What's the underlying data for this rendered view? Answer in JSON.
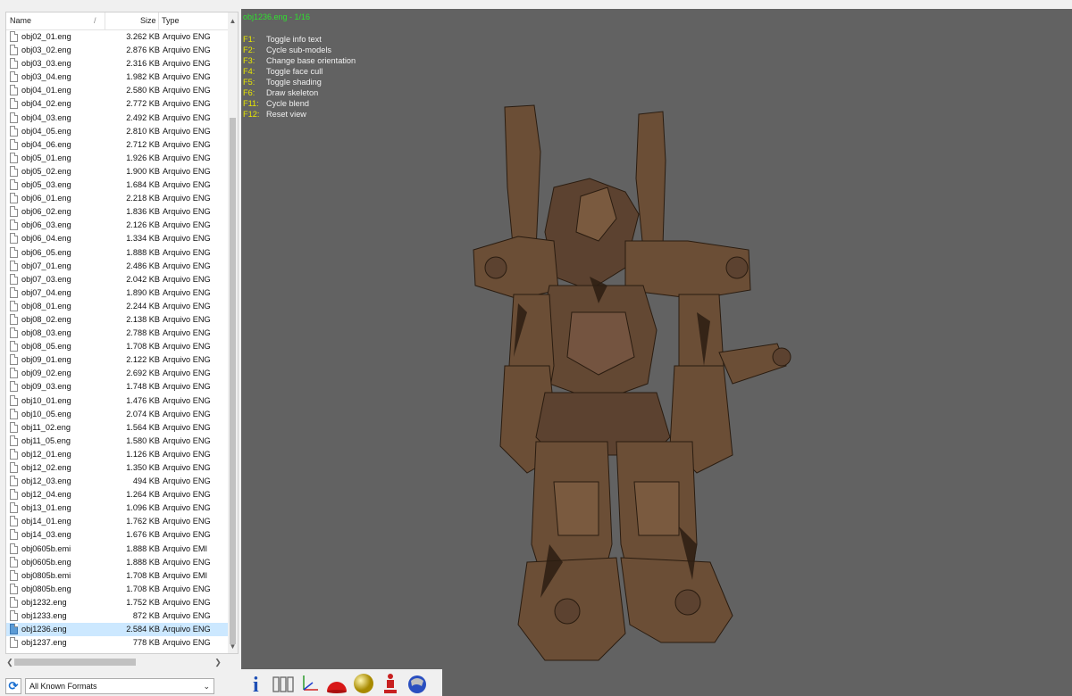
{
  "file_list": {
    "columns": {
      "name": "Name",
      "size": "Size",
      "type": "Type"
    },
    "files": [
      {
        "name": "obj02_01.eng",
        "size": "3.262 KB",
        "type": "Arquivo ENG"
      },
      {
        "name": "obj03_02.eng",
        "size": "2.876 KB",
        "type": "Arquivo ENG"
      },
      {
        "name": "obj03_03.eng",
        "size": "2.316 KB",
        "type": "Arquivo ENG"
      },
      {
        "name": "obj03_04.eng",
        "size": "1.982 KB",
        "type": "Arquivo ENG"
      },
      {
        "name": "obj04_01.eng",
        "size": "2.580 KB",
        "type": "Arquivo ENG"
      },
      {
        "name": "obj04_02.eng",
        "size": "2.772 KB",
        "type": "Arquivo ENG"
      },
      {
        "name": "obj04_03.eng",
        "size": "2.492 KB",
        "type": "Arquivo ENG"
      },
      {
        "name": "obj04_05.eng",
        "size": "2.810 KB",
        "type": "Arquivo ENG"
      },
      {
        "name": "obj04_06.eng",
        "size": "2.712 KB",
        "type": "Arquivo ENG"
      },
      {
        "name": "obj05_01.eng",
        "size": "1.926 KB",
        "type": "Arquivo ENG"
      },
      {
        "name": "obj05_02.eng",
        "size": "1.900 KB",
        "type": "Arquivo ENG"
      },
      {
        "name": "obj05_03.eng",
        "size": "1.684 KB",
        "type": "Arquivo ENG"
      },
      {
        "name": "obj06_01.eng",
        "size": "2.218 KB",
        "type": "Arquivo ENG"
      },
      {
        "name": "obj06_02.eng",
        "size": "1.836 KB",
        "type": "Arquivo ENG"
      },
      {
        "name": "obj06_03.eng",
        "size": "2.126 KB",
        "type": "Arquivo ENG"
      },
      {
        "name": "obj06_04.eng",
        "size": "1.334 KB",
        "type": "Arquivo ENG"
      },
      {
        "name": "obj06_05.eng",
        "size": "1.888 KB",
        "type": "Arquivo ENG"
      },
      {
        "name": "obj07_01.eng",
        "size": "2.486 KB",
        "type": "Arquivo ENG"
      },
      {
        "name": "obj07_03.eng",
        "size": "2.042 KB",
        "type": "Arquivo ENG"
      },
      {
        "name": "obj07_04.eng",
        "size": "1.890 KB",
        "type": "Arquivo ENG"
      },
      {
        "name": "obj08_01.eng",
        "size": "2.244 KB",
        "type": "Arquivo ENG"
      },
      {
        "name": "obj08_02.eng",
        "size": "2.138 KB",
        "type": "Arquivo ENG"
      },
      {
        "name": "obj08_03.eng",
        "size": "2.788 KB",
        "type": "Arquivo ENG"
      },
      {
        "name": "obj08_05.eng",
        "size": "1.708 KB",
        "type": "Arquivo ENG"
      },
      {
        "name": "obj09_01.eng",
        "size": "2.122 KB",
        "type": "Arquivo ENG"
      },
      {
        "name": "obj09_02.eng",
        "size": "2.692 KB",
        "type": "Arquivo ENG"
      },
      {
        "name": "obj09_03.eng",
        "size": "1.748 KB",
        "type": "Arquivo ENG"
      },
      {
        "name": "obj10_01.eng",
        "size": "1.476 KB",
        "type": "Arquivo ENG"
      },
      {
        "name": "obj10_05.eng",
        "size": "2.074 KB",
        "type": "Arquivo ENG"
      },
      {
        "name": "obj11_02.eng",
        "size": "1.564 KB",
        "type": "Arquivo ENG"
      },
      {
        "name": "obj11_05.eng",
        "size": "1.580 KB",
        "type": "Arquivo ENG"
      },
      {
        "name": "obj12_01.eng",
        "size": "1.126 KB",
        "type": "Arquivo ENG"
      },
      {
        "name": "obj12_02.eng",
        "size": "1.350 KB",
        "type": "Arquivo ENG"
      },
      {
        "name": "obj12_03.eng",
        "size": "494 KB",
        "type": "Arquivo ENG"
      },
      {
        "name": "obj12_04.eng",
        "size": "1.264 KB",
        "type": "Arquivo ENG"
      },
      {
        "name": "obj13_01.eng",
        "size": "1.096 KB",
        "type": "Arquivo ENG"
      },
      {
        "name": "obj14_01.eng",
        "size": "1.762 KB",
        "type": "Arquivo ENG"
      },
      {
        "name": "obj14_03.eng",
        "size": "1.676 KB",
        "type": "Arquivo ENG"
      },
      {
        "name": "obj0605b.emi",
        "size": "1.888 KB",
        "type": "Arquivo EMI"
      },
      {
        "name": "obj0605b.eng",
        "size": "1.888 KB",
        "type": "Arquivo ENG"
      },
      {
        "name": "obj0805b.emi",
        "size": "1.708 KB",
        "type": "Arquivo EMI"
      },
      {
        "name": "obj0805b.eng",
        "size": "1.708 KB",
        "type": "Arquivo ENG"
      },
      {
        "name": "obj1232.eng",
        "size": "1.752 KB",
        "type": "Arquivo ENG"
      },
      {
        "name": "obj1233.eng",
        "size": "872 KB",
        "type": "Arquivo ENG"
      },
      {
        "name": "obj1236.eng",
        "size": "2.584 KB",
        "type": "Arquivo ENG",
        "selected": true
      },
      {
        "name": "obj1237.eng",
        "size": "778 KB",
        "type": "Arquivo ENG"
      }
    ]
  },
  "format_filter": {
    "selected": "All Known Formats"
  },
  "viewer": {
    "title": "obj1236.eng - 1/16",
    "shortcuts": [
      {
        "key": "F1:",
        "desc": "Toggle info text"
      },
      {
        "key": "F2:",
        "desc": "Cycle sub-models"
      },
      {
        "key": "F3:",
        "desc": "Change base orientation"
      },
      {
        "key": "F4:",
        "desc": "Toggle face cull"
      },
      {
        "key": "F5:",
        "desc": "Toggle shading"
      },
      {
        "key": "F6:",
        "desc": "Draw skeleton"
      },
      {
        "key": "F11:",
        "desc": "Cycle blend"
      },
      {
        "key": "F12:",
        "desc": "Reset view"
      }
    ]
  },
  "toolbar": {
    "icons": [
      "info-icon",
      "skeleton-icon",
      "axes-icon",
      "hemisphere-icon",
      "sphere-icon",
      "figure-icon",
      "globe-icon"
    ]
  },
  "colors": {
    "viewport_bg": "#626262",
    "title_text": "#2fe02f",
    "shortcut_key": "#e8e800",
    "model_body": "#6b4e36"
  }
}
